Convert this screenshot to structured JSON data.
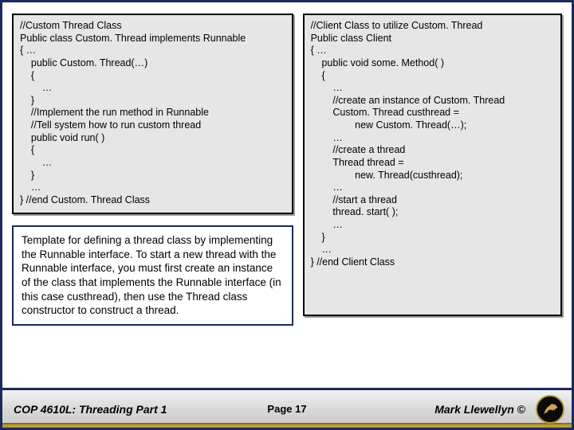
{
  "left_code": "//Custom Thread Class\nPublic class Custom. Thread implements Runnable\n{ …\n    public Custom. Thread(…)\n    {\n        …\n    }\n    //Implement the run method in Runnable\n    //Tell system how to run custom thread\n    public void run( )\n    {\n        …\n    }\n    …\n} //end Custom. Thread Class",
  "right_code": "//Client Class to utilize Custom. Thread\nPublic class Client\n{ …\n    public void some. Method( )\n    {\n        …\n        //create an instance of Custom. Thread\n        Custom. Thread custhread =\n                new Custom. Thread(…);\n        …\n        //create a thread\n        Thread thread =\n                new. Thread(custhread);\n        …\n        //start a thread\n        thread. start( );\n        …\n    }\n    …\n} //end Client Class",
  "description": "Template for defining a thread class by implementing the Runnable interface.  To start a new thread with the Runnable interface, you must first create an instance of the class that implements the Runnable interface (in this case custhread), then use the Thread class constructor to construct a thread.",
  "footer": {
    "course": "COP 4610L: Threading Part 1",
    "page": "Page 17",
    "author": "Mark Llewellyn ©"
  }
}
